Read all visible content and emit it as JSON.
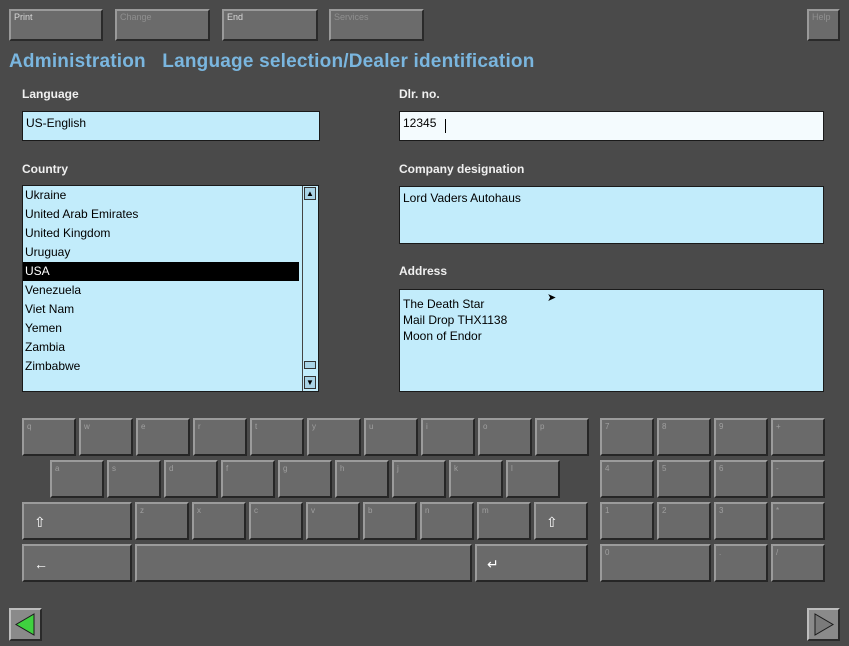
{
  "toolbar": {
    "print": "Print",
    "change": "Change",
    "end": "End",
    "services": "Services",
    "help": "Help"
  },
  "title": "Administration   Language selection/Dealer identification",
  "language": {
    "label": "Language",
    "value": "US-English"
  },
  "dealer": {
    "label": "Dlr. no.",
    "value": "12345"
  },
  "country": {
    "label": "Country",
    "items": [
      "Ukraine",
      "United Arab Emirates",
      "United Kingdom",
      "Uruguay",
      "USA",
      "Venezuela",
      "Viet Nam",
      "Yemen",
      "Zambia",
      "Zimbabwe"
    ],
    "selected": "USA"
  },
  "company": {
    "label": "Company designation",
    "value": "Lord Vaders Autohaus"
  },
  "address": {
    "label": "Address",
    "lines": [
      "The Death Star",
      "Mail Drop THX1138",
      "Moon of Endor"
    ]
  },
  "keyboard": {
    "row1": [
      "q",
      "w",
      "e",
      "r",
      "t",
      "y",
      "u",
      "i",
      "o",
      "p"
    ],
    "row2": [
      "a",
      "s",
      "d",
      "f",
      "g",
      "h",
      "j",
      "k",
      "l"
    ],
    "row3": [
      "z",
      "x",
      "c",
      "v",
      "b",
      "n",
      "m"
    ],
    "shift_icon": "shift-arrow-icon",
    "backspace_icon": "backspace-arrow-icon",
    "enter_icon": "enter-arrow-icon",
    "numpad": [
      "7",
      "8",
      "9",
      "+",
      "4",
      "5",
      "6",
      "-",
      "1",
      "2",
      "3",
      "*",
      "0",
      ".",
      "/"
    ]
  },
  "nav": {
    "back_icon": "left-arrow-icon",
    "forward_icon": "right-arrow-icon",
    "back_color": "#3fd13f"
  }
}
